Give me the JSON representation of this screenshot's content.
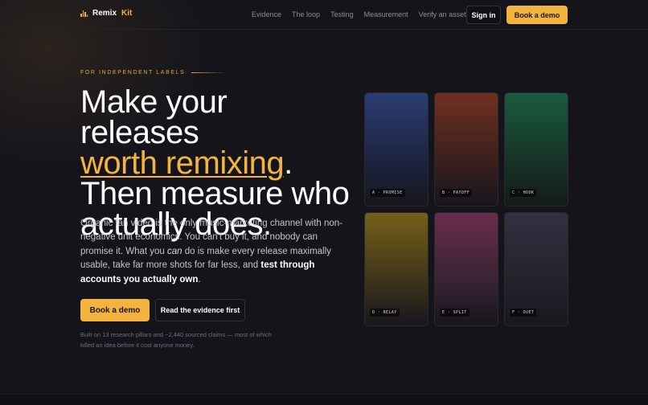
{
  "brand": {
    "name_part1": "Remix",
    "name_part2": "Kit"
  },
  "nav": {
    "links": [
      "Evidence",
      "The loop",
      "Testing",
      "Measurement",
      "Verify an asset"
    ],
    "sign_in": "Sign in",
    "book_demo": "Book a demo"
  },
  "hero": {
    "eyebrow": "FOR INDEPENDENT LABELS",
    "headline_1": "Make your releases",
    "headline_accent": "worth remixing",
    "headline_period": ".",
    "headline_2": "Then measure who actually does.",
    "body_1": "Organic fan video is the only music-marketing channel with non-negative unit economics. You can't buy it, and nobody can promise it. What you ",
    "body_em": "can",
    "body_2": " do is make every release maximally usable, take far more shots for far less, and ",
    "body_bold": "test through accounts you actually own",
    "body_3": ".",
    "cta_primary": "Book a demo",
    "cta_secondary": "Read the evidence first",
    "footnote": "Built on 13 research pillars and ~2,440 sourced claims — most of which killed an idea before it cost anyone money."
  },
  "cards": [
    {
      "tag": "A · PROMISE",
      "color": "#2b3d74"
    },
    {
      "tag": "B · PAYOFF",
      "color": "#713021"
    },
    {
      "tag": "C · HOOK",
      "color": "#1a5a40"
    },
    {
      "tag": "D · RELAY",
      "color": "#756018"
    },
    {
      "tag": "E · SPLIT",
      "color": "#6a2c4d"
    },
    {
      "tag": "F · DUET",
      "color": "#303040"
    }
  ],
  "colors": {
    "accent": "#f3b43f",
    "background": "#15141b"
  }
}
